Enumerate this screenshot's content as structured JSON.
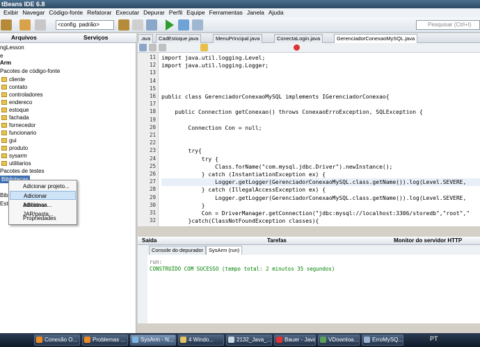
{
  "window": {
    "title": "tBeans IDE 6.8"
  },
  "menu": [
    "Exibir",
    "Navegar",
    "Código-fonte",
    "Refatorar",
    "Executar",
    "Depurar",
    "Perfil",
    "Equipe",
    "Ferramentas",
    "Janela",
    "Ajuda"
  ],
  "toolbar": {
    "config": "<config. padrão>",
    "search_placeholder": "Pesquisar (Ctrl+I)"
  },
  "left_tabs": {
    "files": "Arquivos",
    "services": "Serviços"
  },
  "tree": [
    "ngLesson",
    "e",
    "Arm",
    "Pacotes de código-fonte",
    "cliente",
    "contato",
    "controladores",
    "endereco",
    "estoque",
    "fachada",
    "fornecedor",
    "funcionario",
    "gui",
    "produto",
    "sysarm",
    "utilitarios",
    "Pacotes de testes",
    "Bibliotecas",
    "Biblio",
    "Esto"
  ],
  "context_menu": [
    "Adicionar projeto...",
    "Adicionar biblioteca...",
    "Adicionar JAR/pasta...",
    "Propriedades"
  ],
  "editor_tabs": [
    ".ava",
    "CadEstoque.java",
    "MenuPrincipal.java",
    "ConectaLogin.java",
    "GerenciadorConexaoMySQL.java"
  ],
  "line_numbers": [
    "11",
    "12",
    "13",
    "14",
    "15",
    "16",
    "17",
    "18",
    "19",
    "20",
    "21",
    "22",
    "23",
    "24",
    "25",
    "26",
    "27",
    "28",
    "29",
    "30",
    "31",
    "32"
  ],
  "code": [
    "import java.util.logging.Level;",
    "import java.util.logging.Logger;",
    "",
    "",
    "",
    "public class GerenciadorConexaoMySQL implements IGerenciadorConexao{",
    "",
    "    public Connection getConexao() throws ConexaoErroException, SQLException {",
    "",
    "        Connection Con = null;",
    "",
    "",
    "        try{",
    "            try {",
    "                Class.forName(\"com.mysql.jdbc.Driver\").newInstance();",
    "            } catch (InstantiationException ex) {",
    "                Logger.getLogger(GerenciadorConexaoMySQL.class.getName()).log(Level.SEVERE,",
    "            } catch (IllegalAccessException ex) {",
    "                Logger.getLogger(GerenciadorConexaoMySQL.class.getName()).log(Level.SEVERE,",
    "            }",
    "            Con = DriverManager.getConnection(\"jdbc:mysql://localhost:3306/storedb\",\"root\",\"",
    "        }catch(ClassNotFoundException classes){"
  ],
  "output": {
    "panel": "Saída",
    "tasks": "Tarefas",
    "http": "Monitor do servidor HTTP",
    "tabs": [
      "Console do depurador",
      "SysArm (run)"
    ],
    "lines": [
      "run:",
      "CONSTRUÍDO COM SUCESSO (tempo total: 2 minutos 35 segundos)"
    ]
  },
  "taskbar": [
    "Conexão O...",
    "Problemas ...",
    "SysArm - N...",
    "4 Windo...",
    "2132_Java_...",
    "Bauer - Java...",
    "VDownloa...",
    "ErroMySQ...",
    "PT"
  ]
}
